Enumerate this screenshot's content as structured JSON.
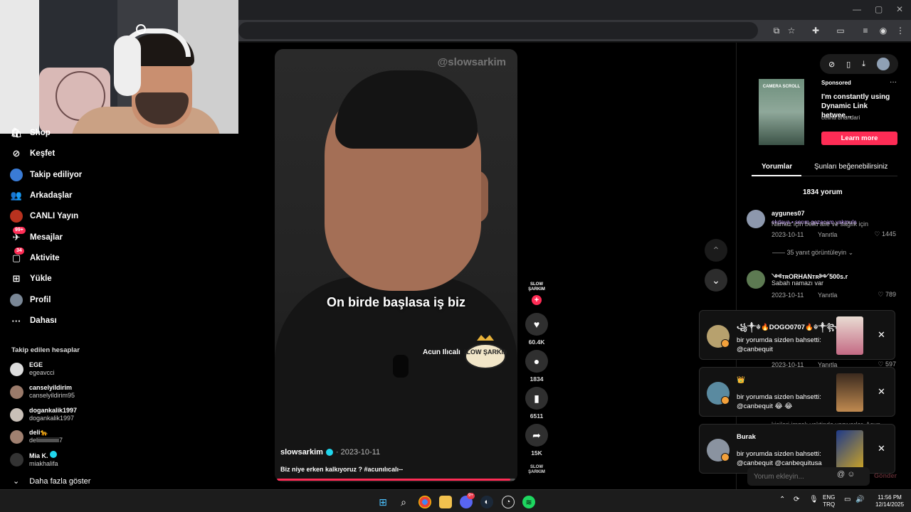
{
  "browser": {
    "window_controls": [
      "—",
      "▢",
      "✕"
    ],
    "toolbar_icons": [
      "cast-icon",
      "star-icon",
      "extensions-icon",
      "reader-icon",
      "media-icon",
      "profile-icon",
      "menu-icon"
    ]
  },
  "sidebar": {
    "items": [
      {
        "label": "Shop",
        "icon": "shop-icon"
      },
      {
        "label": "Keşfet",
        "icon": "compass-icon"
      },
      {
        "label": "Takip ediliyor",
        "icon": "following-icon"
      },
      {
        "label": "Arkadaşlar",
        "icon": "friends-icon"
      },
      {
        "label": "CANLI Yayın",
        "icon": "live-icon"
      },
      {
        "label": "Mesajlar",
        "icon": "messages-icon",
        "badge": "99+"
      },
      {
        "label": "Aktivite",
        "icon": "activity-icon",
        "badge": "34"
      },
      {
        "label": "Yükle",
        "icon": "upload-icon"
      },
      {
        "label": "Profil",
        "icon": "profile-icon"
      },
      {
        "label": "Dahası",
        "icon": "more-icon"
      }
    ],
    "following_title": "Takip edilen hesaplar",
    "following": [
      {
        "name": "EGE",
        "handle": "egeavcci"
      },
      {
        "name": "canselyildirim",
        "handle": "canselyildirim95"
      },
      {
        "name": "dogankalik1997",
        "handle": "dogankalik1997"
      },
      {
        "name": "deli🐆",
        "handle": "deliiiiiiiiiiiiiii7"
      },
      {
        "name": "Mia K.",
        "handle": "miakhalifa"
      }
    ],
    "show_more": "Daha fazla göster"
  },
  "video": {
    "watermark": "@slowsarkim",
    "caption": "On birde başlasa iş biz",
    "name_tag": "Acun Ilıcalı",
    "logo_text": "SLOW ŞARKIM",
    "author": "slowsarkim",
    "date": "· 2023-10-11",
    "description": "Biz niye erken kalkıyoruz ? #acunılıcalı--",
    "progress": 0.98
  },
  "actions": {
    "creator_label": "SLOW ŞARKIM",
    "likes": "60.4K",
    "comments": "1834",
    "saves": "6511",
    "shares": "15K",
    "music_label": "SLOW ŞARKIM"
  },
  "right_panel": {
    "sponsored": {
      "label": "Sponsored",
      "title": "I'm constantly using Dynamic Link betwee...",
      "author": "celina bhandari",
      "cta": "Learn more",
      "thumb_text": "CAMERA SCROLL"
    },
    "tabs": [
      "Yorumlar",
      "Şunları beğenebilirsiniz"
    ],
    "comment_count": "1834 yorum",
    "comments": [
      {
        "name": "aygunes07",
        "overlay": "okdaya • serım gazacam yakmula",
        "text": "Namaz için belki aile ve sağlık için",
        "date": "2023-10-11",
        "reply": "Yanıtla",
        "likes": "1445"
      },
      {
        "name": "༺ᴛʀORHANᴛʀ༻500s.r",
        "text": "Sabah namazı var",
        "date": "2023-10-11",
        "reply": "Yanıtla",
        "likes": "789"
      },
      {
        "date": "2023-10-11",
        "reply": "Yanıtla",
        "likes": "597"
      }
    ],
    "view_replies": "35 yanıt görüntüleyin",
    "hidden_text": "kişileri imzalı vaktinde yazıyorlar. Acun",
    "input_placeholder": "Yorum ekleyin...",
    "send": "Gönder"
  },
  "notifications": [
    {
      "name": "꧁༒☬🔥DOGO0707🔥☬༒꧂",
      "line1": "bir yorumda sizden bahsetti:",
      "line2": "@canbequit"
    },
    {
      "name": "👑",
      "line1": "bir yorumda sizden bahsetti:",
      "line2": "@canbequit 😂 😂"
    },
    {
      "name": "Burak",
      "line1": "bir yorumda sizden bahsetti:",
      "line2": "@canbequit @canbequitusa"
    }
  ],
  "taskbar": {
    "apps": [
      "windows-start-icon",
      "search-icon",
      "chrome-icon",
      "file-explorer-icon",
      "discord-icon",
      "steam-icon",
      "obs-icon",
      "spotify-icon"
    ],
    "discord_badge": "9+",
    "lang": "ENG",
    "layout": "TRQ",
    "time": "11:56 PM",
    "date": "12/14/2025"
  },
  "colors": {
    "accent": "#fe2c55",
    "verified": "#20d5ec",
    "background": "#000000"
  }
}
